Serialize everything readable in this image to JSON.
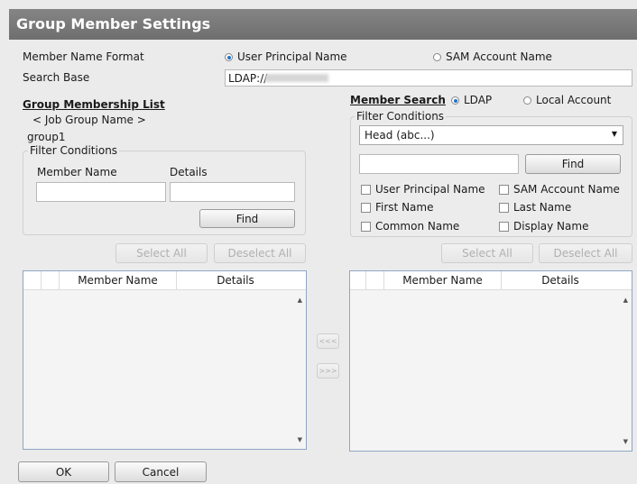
{
  "dialog": {
    "title": "Group Member Settings"
  },
  "format": {
    "label": "Member Name Format",
    "options": [
      "User Principal Name",
      "SAM Account Name"
    ],
    "selected": "User Principal Name"
  },
  "search_base": {
    "label": "Search Base",
    "value": "LDAP://"
  },
  "membership": {
    "heading": "Group Membership List",
    "group_name_label": "< Job Group Name >",
    "group_name": "group1",
    "filter_legend": "Filter Conditions",
    "member_name_label": "Member Name",
    "details_label": "Details",
    "member_name_value": "",
    "details_value": "",
    "find_label": "Find",
    "select_all_label": "Select All",
    "deselect_all_label": "Deselect All",
    "columns": [
      "Member Name",
      "Details"
    ],
    "rows": []
  },
  "transfer": {
    "add_label": "<<<",
    "remove_label": ">>>"
  },
  "member_search": {
    "heading": "Member Search",
    "sources": [
      "LDAP",
      "Local Account"
    ],
    "selected_source": "LDAP",
    "filter_legend": "Filter Conditions",
    "dropdown_value": "Head (abc...)",
    "search_value": "",
    "find_label": "Find",
    "checkboxes": {
      "upn": "User Principal Name",
      "sam": "SAM Account Name",
      "first": "First Name",
      "last": "Last Name",
      "common": "Common Name",
      "display": "Display Name"
    },
    "select_all_label": "Select All",
    "deselect_all_label": "Deselect All",
    "columns": [
      "Member Name",
      "Details"
    ],
    "rows": []
  },
  "footer": {
    "ok_label": "OK",
    "cancel_label": "Cancel"
  },
  "colors": {
    "title_bar": "#7a7a7a",
    "radio_accent": "#1f73c8",
    "list_border": "#8fa6c4"
  },
  "icons": {
    "dropdown": "chevron-down-icon",
    "scroll_up": "scroll-up-icon",
    "scroll_down": "scroll-down-icon"
  }
}
